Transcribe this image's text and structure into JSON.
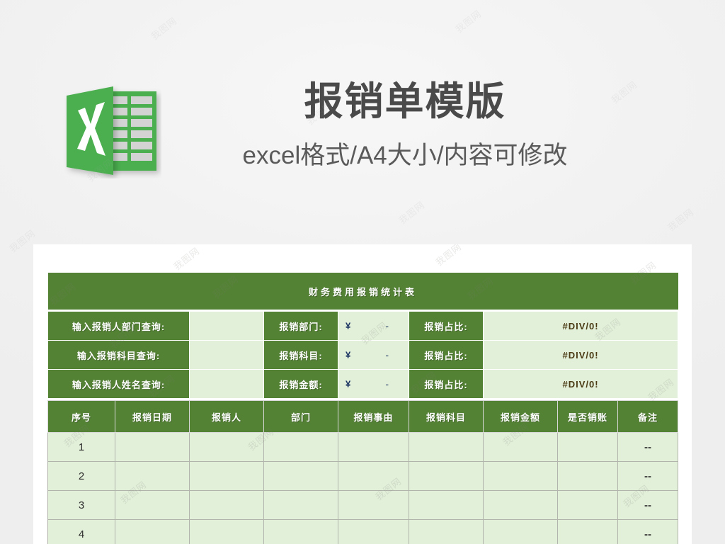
{
  "promo": {
    "icon_name": "excel-file-icon",
    "title": "报销单模版",
    "subtitle": "excel格式/A4大小/内容可修改"
  },
  "watermark": {
    "text": "我图网"
  },
  "colors": {
    "header_green": "#548235",
    "cell_light_green": "#e2efd9",
    "page_background": "#f1f1f1",
    "sheet_white": "#ffffff",
    "title_text": "#4a4a4a",
    "grid_line": "#b0b4aa"
  },
  "spreadsheet": {
    "banner_title": "财务费用报销统计表",
    "query_rows": [
      {
        "query_label": "输入报销人部门查询:",
        "query_value": "",
        "stat_label": "报销部门:",
        "currency": "¥",
        "amount": "-",
        "ratio_label": "报销占比:",
        "ratio_value": "#DIV/0!"
      },
      {
        "query_label": "输入报销科目查询:",
        "query_value": "",
        "stat_label": "报销科目:",
        "currency": "¥",
        "amount": "-",
        "ratio_label": "报销占比:",
        "ratio_value": "#DIV/0!"
      },
      {
        "query_label": "输入报销人姓名查询:",
        "query_value": "",
        "stat_label": "报销金额:",
        "currency": "¥",
        "amount": "-",
        "ratio_label": "报销占比:",
        "ratio_value": "#DIV/0!"
      }
    ],
    "columns": [
      "序号",
      "报销日期",
      "报销人",
      "部门",
      "报销事由",
      "报销科目",
      "报销金额",
      "是否销账",
      "备注"
    ],
    "rows": [
      {
        "index": "1",
        "date": "",
        "person": "",
        "dept": "",
        "reason": "",
        "subject": "",
        "amount": "",
        "settled": "",
        "remark": "--"
      },
      {
        "index": "2",
        "date": "",
        "person": "",
        "dept": "",
        "reason": "",
        "subject": "",
        "amount": "",
        "settled": "",
        "remark": "--"
      },
      {
        "index": "3",
        "date": "",
        "person": "",
        "dept": "",
        "reason": "",
        "subject": "",
        "amount": "",
        "settled": "",
        "remark": "--"
      },
      {
        "index": "4",
        "date": "",
        "person": "",
        "dept": "",
        "reason": "",
        "subject": "",
        "amount": "",
        "settled": "",
        "remark": "--"
      }
    ]
  }
}
